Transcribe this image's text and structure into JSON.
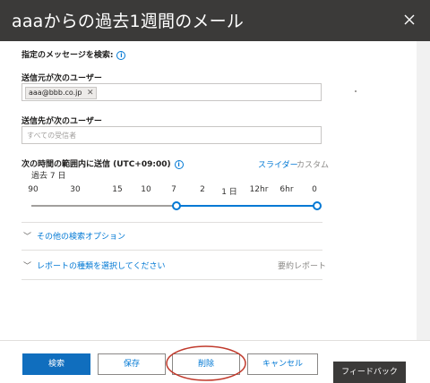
{
  "header": {
    "title": "aaaからの過去1週間のメール"
  },
  "search_section": {
    "title": "指定のメッセージを検索:"
  },
  "sender": {
    "label": "送信元が次のユーザー",
    "chips": [
      "aaa@bbb.co.jp"
    ]
  },
  "recipient": {
    "label": "送信先が次のユーザー",
    "placeholder": "すべての受信者"
  },
  "time_range": {
    "label": "次の時間の範囲内に送信 (UTC+09:00)",
    "mode_slider": "スライダー",
    "mode_custom": "カスタム",
    "current": "過去 7 日",
    "ticks": [
      "90",
      "30",
      "15",
      "10",
      "7",
      "2",
      "1 日",
      "12hr",
      "6hr",
      "0"
    ],
    "selected_tick": "7"
  },
  "more_options": {
    "label": "その他の検索オプション"
  },
  "report_type": {
    "label": "レポートの種類を選択してください",
    "value": "要約レポート"
  },
  "buttons": {
    "search": "検索",
    "save": "保存",
    "delete": "削除",
    "cancel": "キャンセル"
  },
  "feedback": {
    "label": "フィードバック"
  },
  "colors": {
    "accent": "#0078d4",
    "header": "#3b3a39",
    "highlight": "#c0392b"
  }
}
